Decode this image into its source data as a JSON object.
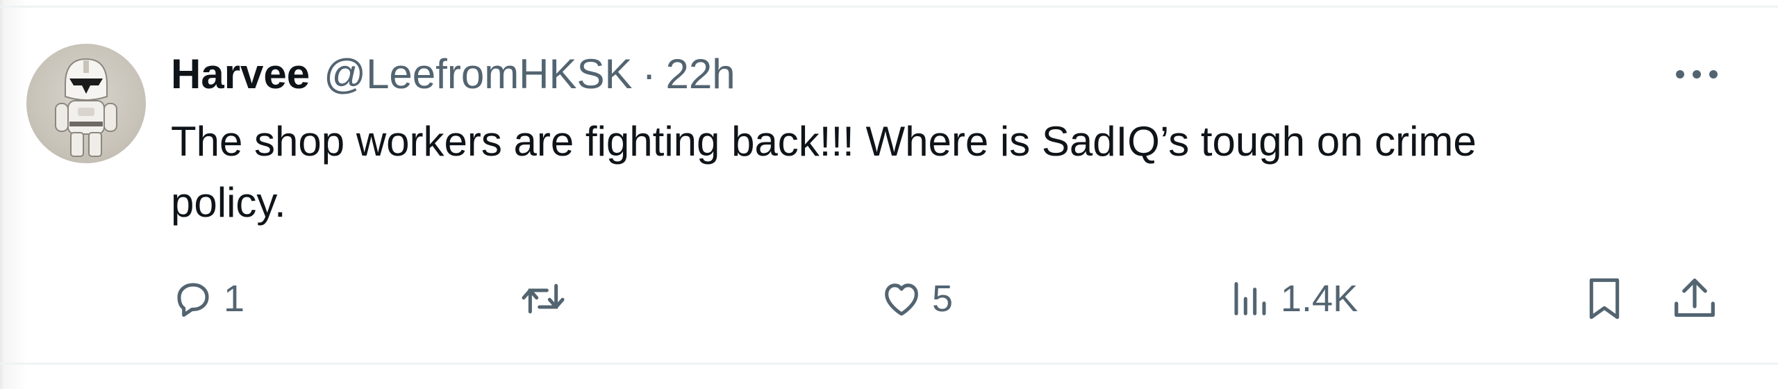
{
  "tweet": {
    "author": {
      "display_name": "Harvee",
      "handle": "@LeefromHKSK",
      "avatar_icon": "clone-trooper-figure-avatar"
    },
    "separator": "·",
    "time": "22h",
    "text": "The shop workers are fighting back!!! Where is SadIQ’s tough on crime\npolicy.",
    "more_icon": "ellipsis-icon",
    "actions": {
      "reply": {
        "icon": "reply-icon",
        "count": "1"
      },
      "retweet": {
        "icon": "retweet-icon",
        "count": ""
      },
      "like": {
        "icon": "heart-icon",
        "count": "5"
      },
      "views": {
        "icon": "views-chart-icon",
        "count": "1.4K"
      },
      "bookmark": {
        "icon": "bookmark-icon"
      },
      "share": {
        "icon": "share-icon"
      }
    }
  },
  "colors": {
    "text_primary": "#0f1419",
    "text_secondary": "#536471",
    "divider": "#eff3f4",
    "background": "#ffffff"
  }
}
